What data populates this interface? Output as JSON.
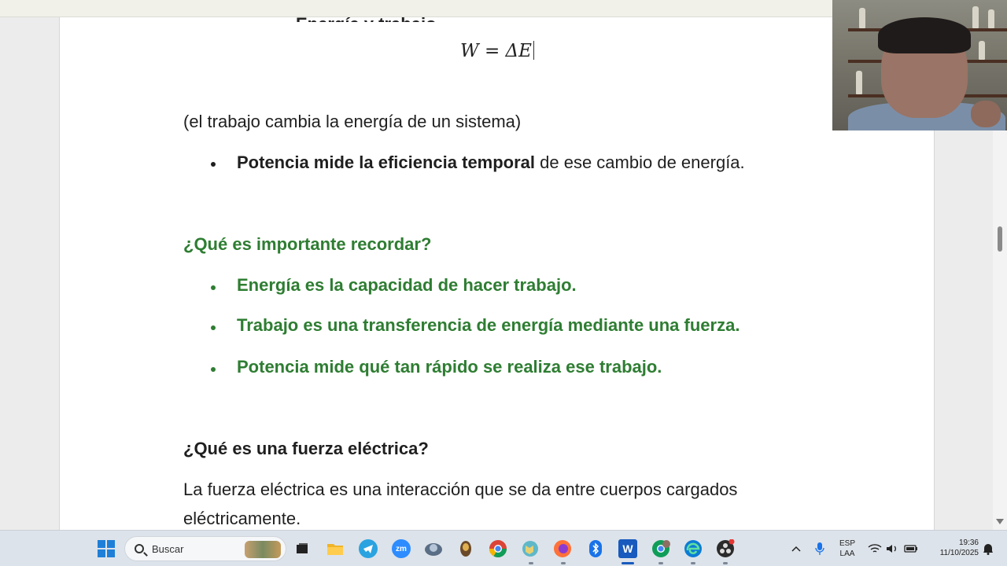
{
  "document": {
    "clipped_heading": "Energía y trabajo",
    "formula": "W = ΔE",
    "line1": "(el trabajo cambia la energía de un sistema)",
    "bullet1_bold": "Potencia mide la eficiencia temporal",
    "bullet1_rest": " de ese cambio de energía.",
    "section1_heading": "¿Qué es importante recordar?",
    "green_bullets": [
      "Energía es la capacidad de hacer trabajo.",
      "Trabajo es una transferencia de energía mediante una fuerza.",
      "Potencia mide qué tan rápido se realiza ese trabajo."
    ],
    "section2_heading": "¿Qué es una fuerza eléctrica?",
    "para_line1": "La fuerza eléctrica es una interacción que se da entre cuerpos cargados",
    "para_line2": "eléctricamente."
  },
  "taskbar": {
    "search_label": "Buscar",
    "apps": [
      "start-icon",
      "search-box",
      "task-view-icon",
      "file-explorer-icon",
      "telegram-icon",
      "zoom-icon",
      "network-app-icon",
      "game-app-icon",
      "chrome-icon",
      "maps-app-icon",
      "firefox-icon",
      "bluetooth-icon",
      "word-icon",
      "chrome-profile-icon",
      "edge-icon",
      "obs-icon"
    ],
    "zoom_label": "zm",
    "word_label": "W"
  },
  "tray": {
    "language_line1": "ESP",
    "language_line2": "LAA",
    "time": "19:36",
    "date": "11/10/2025"
  },
  "colors": {
    "accent_green": "#2e7d32",
    "taskbar": "#dde3ea"
  }
}
